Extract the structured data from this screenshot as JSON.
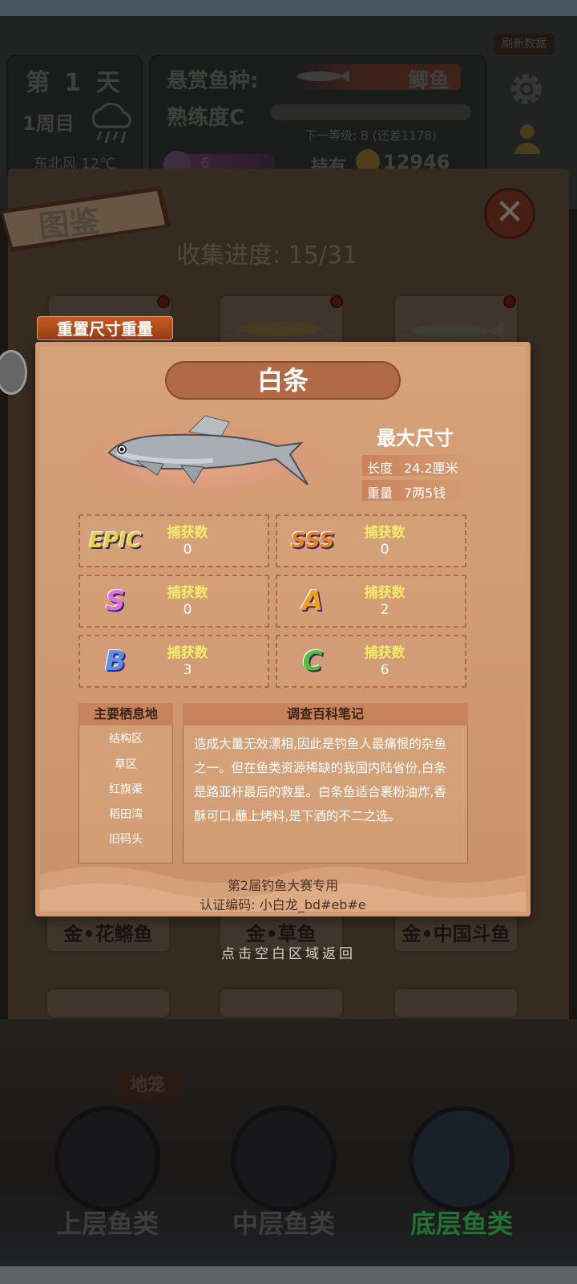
{
  "hud": {
    "day": "第 1 天",
    "week": "1周目",
    "weather": "东北风 12℃",
    "bounty_label": "悬赏鱼种:",
    "bounty_fish": "鲫鱼",
    "proficiency": "熟练度C",
    "next_level": "下一等级: B (还差1178)",
    "purple_value": "6",
    "hold_label": "持有",
    "coins": "12946",
    "refresh": "刷新数据"
  },
  "codex": {
    "title": "图鉴",
    "progress": "收集进度: 15/31",
    "reset_button": "重置尺寸重量",
    "close": "✕"
  },
  "bg_cards": {
    "names": [
      "金•花鳉鱼",
      "金•草鱼",
      "金•中国斗鱼"
    ]
  },
  "popup": {
    "fish_name": "白条",
    "max_size_label": "最大尺寸",
    "length_label": "长度",
    "length_value": "24.2厘米",
    "weight_label": "重量",
    "weight_value": "7两5钱",
    "grades": [
      {
        "grade": "EPIC",
        "label": "捕获数",
        "count": "0",
        "color": "#e8d040"
      },
      {
        "grade": "SSS",
        "label": "捕获数",
        "count": "0",
        "color": "#f08020"
      },
      {
        "grade": "S",
        "label": "捕获数",
        "count": "0",
        "color": "#e070e0"
      },
      {
        "grade": "A",
        "label": "捕获数",
        "count": "2",
        "color": "#f0a020"
      },
      {
        "grade": "B",
        "label": "捕获数",
        "count": "3",
        "color": "#5890f0"
      },
      {
        "grade": "C",
        "label": "捕获数",
        "count": "6",
        "color": "#50c040"
      }
    ],
    "habitat_title": "主要栖息地",
    "habitats": [
      "结构区",
      "草区",
      "红旗渠",
      "稻田湾",
      "旧码头"
    ],
    "notes_title": "调查百科笔记",
    "notes": "造成大量无效漂相,因此是钓鱼人最痛恨的杂鱼之一。但在鱼类资源稀缺的我国内陆省份,白条是路亚杆最后的救星。白条鱼适合裹粉油炸,香酥可口,蘸上烤料,是下酒的不二之选。",
    "contest": "第2届钓鱼大赛专用",
    "auth": "认证编码: 小白龙_bd#eb#e"
  },
  "hint": "点击空白区域返回",
  "tabs": {
    "dilong": "地笼",
    "upper": "上层鱼类",
    "middle": "中层鱼类",
    "bottom": "底层鱼类"
  },
  "colors": {
    "popup_bg": "#d29a70",
    "grade_label": "#f2ec66",
    "active_tab": "#3cc45a"
  }
}
